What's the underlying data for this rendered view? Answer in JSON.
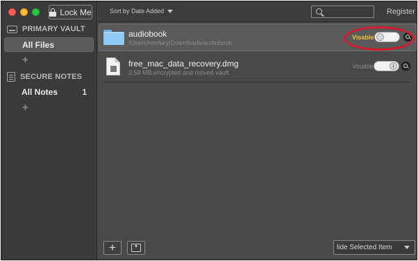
{
  "sidebar": {
    "lock_label": "Lock Me",
    "primary_vault": "PRIMARY VAULT",
    "all_files": "All Files",
    "secure_notes": "SECURE NOTES",
    "all_notes": "All Notes",
    "all_notes_count": "1",
    "add_symbol": "+"
  },
  "toolbar": {
    "sort_label": "Sort by Date Added",
    "register_label": "Register"
  },
  "files": [
    {
      "name": "audiobook",
      "detail": "/Users/merkey/Downloads/audiobook",
      "visibility_label": "Visable",
      "icon": "folder-icon",
      "toggle_state": "off"
    },
    {
      "name": "free_mac_data_recovery.dmg",
      "detail": "3.58 MB,encrypted and moved vault.",
      "visibility_label": "Visable",
      "icon": "dmg-file-icon",
      "toggle_state": "on"
    }
  ],
  "bottom": {
    "add_symbol": "+",
    "hide_selected_label": "lide Selected Item"
  },
  "colors": {
    "highlight": "#d8192c",
    "visible_label_active": "#f0c233",
    "window_bg": "#494949",
    "sidebar_bg": "#3a3a3c"
  }
}
